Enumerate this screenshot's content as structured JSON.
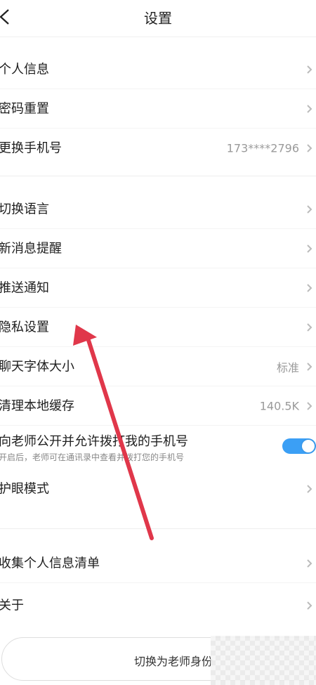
{
  "header": {
    "title": "设置"
  },
  "group1": [
    {
      "label": "个人信息",
      "value": ""
    },
    {
      "label": "密码重置",
      "value": ""
    },
    {
      "label": "更换手机号",
      "value": "173****2796"
    }
  ],
  "group2": [
    {
      "label": "切换语言",
      "value": ""
    },
    {
      "label": "新消息提醒",
      "value": ""
    },
    {
      "label": "推送通知",
      "value": ""
    },
    {
      "label": "隐私设置",
      "value": ""
    },
    {
      "label": "聊天字体大小",
      "value": "标准"
    },
    {
      "label": "清理本地缓存",
      "value": "140.5K"
    }
  ],
  "phone_toggle": {
    "label": "向老师公开并允许拨打我的手机号",
    "hint": "开启后，老师可在通讯录中查看并拨打您的手机号",
    "on": true
  },
  "eye_mode": {
    "label": "护眼模式"
  },
  "group3": [
    {
      "label": "收集个人信息清单"
    },
    {
      "label": "关于"
    }
  ],
  "switch_role": {
    "label": "切换为老师身份"
  },
  "colors": {
    "accent": "#3b9ff5",
    "annotation_arrow": "#e0374a"
  }
}
